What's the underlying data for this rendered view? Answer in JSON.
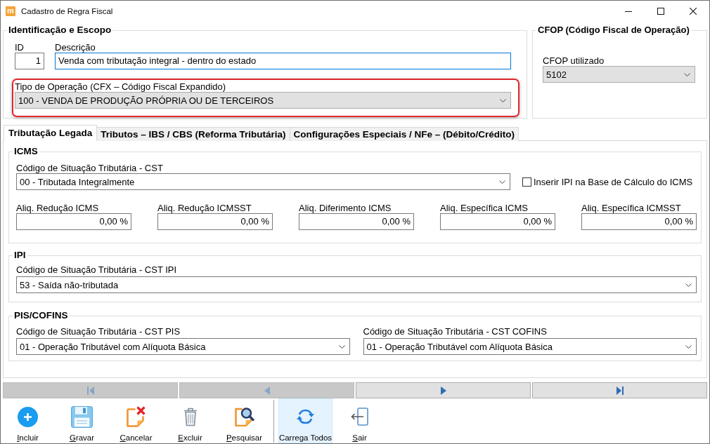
{
  "window": {
    "title": "Cadastro de Regra Fiscal",
    "app_icon": "m"
  },
  "identification": {
    "title": "Identificação e Escopo",
    "id": {
      "label": "ID",
      "value": "1",
      "focused": false
    },
    "description": {
      "label": "Descrição",
      "value": "Venda com tributação integral - dentro do estado",
      "focused": true
    },
    "operation_type": {
      "label": "Tipo de Operação (CFX – Código Fiscal Expandido)",
      "value": "100 - VENDA DE PRODUÇÃO PRÓPRIA OU DE TERCEIROS",
      "kind": "dropdown",
      "highlighted": true
    }
  },
  "cfop": {
    "title": "CFOP (Código Fiscal de Operação)",
    "field": {
      "label": "CFOP utilizado",
      "value": "5102",
      "kind": "dropdown"
    }
  },
  "tabs": [
    {
      "label": "Tributação Legada",
      "selected": true
    },
    {
      "label": "Tributos – IBS / CBS (Reforma Tributária)",
      "selected": false
    },
    {
      "label": "Configurações Especiais / NFe – (Débito/Crédito)",
      "selected": false
    }
  ],
  "tab_panel": {
    "icms": {
      "title": "ICMS",
      "cst": {
        "label": "Código de Situação Tributária - CST",
        "value": "00 - Tributada Integralmente",
        "kind": "editable"
      },
      "ipi_in_base": {
        "label": "Inserir IPI na Base de Cálculo do ICMS",
        "checked": false
      },
      "rates": [
        {
          "label": "Aliq. Redução ICMS",
          "value": "0,00 %",
          "focused": false
        },
        {
          "label": "Aliq. Redução ICMSST",
          "value": "0,00 %",
          "focused": false
        },
        {
          "label": "Aliq. Diferimento ICMS",
          "value": "0,00 %",
          "focused": false
        },
        {
          "label": "Aliq. Específica ICMS",
          "value": "0,00 %",
          "focused": false
        },
        {
          "label": "Aliq. Específica ICMSST",
          "value": "0,00 %",
          "focused": false
        }
      ]
    },
    "ipi": {
      "title": "IPI",
      "cst": {
        "label": "Código de Situação Tributária - CST IPI",
        "value": "53 - Saída não-tributada",
        "kind": "editable"
      }
    },
    "pis_cofins": {
      "title": "PIS/COFINS",
      "fields": [
        {
          "label": "Código de Situação Tributária - CST PIS",
          "value": "01 - Operação Tributável com Alíquota Básica",
          "kind": "editable"
        },
        {
          "label": "Código de Situação Tributária - CST COFINS",
          "value": "01 - Operação Tributável com Alíquota Básica",
          "kind": "editable"
        }
      ]
    }
  },
  "navigator": [
    {
      "kind": "first",
      "disabled": true
    },
    {
      "kind": "previous",
      "disabled": true
    },
    {
      "kind": "next",
      "disabled": false
    },
    {
      "kind": "last",
      "disabled": false
    }
  ],
  "toolbar": {
    "groups": [
      {
        "buttons": [
          {
            "label": "Incluir",
            "kind": "add",
            "mnemonic": true,
            "highlighted": false
          },
          {
            "label": "Gravar",
            "kind": "save",
            "mnemonic": true,
            "highlighted": false
          },
          {
            "label": "Cancelar",
            "kind": "cancel",
            "mnemonic": true,
            "highlighted": false
          },
          {
            "label": "Excluir",
            "kind": "delete",
            "mnemonic": true,
            "highlighted": false
          },
          {
            "label": "Pesquisar",
            "kind": "search",
            "mnemonic": true,
            "highlighted": false
          }
        ]
      },
      {
        "buttons": [
          {
            "label": "Carrega Todos",
            "kind": "refresh",
            "mnemonic": false,
            "highlighted": true
          },
          {
            "label": "Sair",
            "kind": "exit",
            "mnemonic": true,
            "highlighted": false
          }
        ]
      }
    ]
  }
}
